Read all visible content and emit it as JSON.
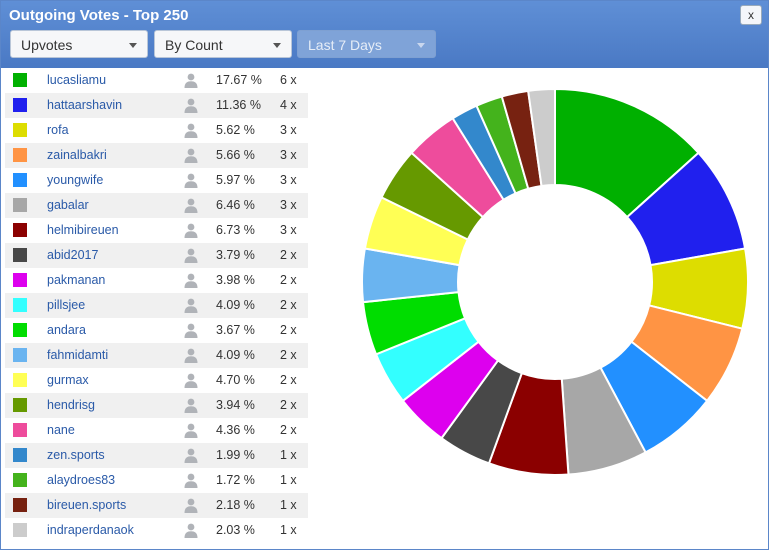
{
  "window": {
    "title": "Outgoing Votes - Top 250",
    "close_label": "x"
  },
  "filters": {
    "vote_type": "Upvotes",
    "sort": "By Count",
    "period": "Last 7 Days"
  },
  "rows": [
    {
      "name": "lucasliamu",
      "percent": "17.67 %",
      "count": "6 x",
      "color": "#00b000",
      "value": 6
    },
    {
      "name": "hattaarshavin",
      "percent": "11.36 %",
      "count": "4 x",
      "color": "#2020ee",
      "value": 4
    },
    {
      "name": "rofa",
      "percent": "5.62 %",
      "count": "3 x",
      "color": "#dddd00",
      "value": 3
    },
    {
      "name": "zainalbakri",
      "percent": "5.66 %",
      "count": "3 x",
      "color": "#ff9444",
      "value": 3
    },
    {
      "name": "youngwife",
      "percent": "5.97 %",
      "count": "3 x",
      "color": "#2290ff",
      "value": 3
    },
    {
      "name": "gabalar",
      "percent": "6.46 %",
      "count": "3 x",
      "color": "#a7a7a7",
      "value": 3
    },
    {
      "name": "helmibireuen",
      "percent": "6.73 %",
      "count": "3 x",
      "color": "#8b0000",
      "value": 3
    },
    {
      "name": "abid2017",
      "percent": "3.79 %",
      "count": "2 x",
      "color": "#484848",
      "value": 2
    },
    {
      "name": "pakmanan",
      "percent": "3.98 %",
      "count": "2 x",
      "color": "#dd00ee",
      "value": 2
    },
    {
      "name": "pillsjee",
      "percent": "4.09 %",
      "count": "2 x",
      "color": "#33ffff",
      "value": 2
    },
    {
      "name": "andara",
      "percent": "3.67 %",
      "count": "2 x",
      "color": "#00dd00",
      "value": 2
    },
    {
      "name": "fahmidamti",
      "percent": "4.09 %",
      "count": "2 x",
      "color": "#6ab4f0",
      "value": 2
    },
    {
      "name": "gurmax",
      "percent": "4.70 %",
      "count": "2 x",
      "color": "#ffff55",
      "value": 2
    },
    {
      "name": "hendrisg",
      "percent": "3.94 %",
      "count": "2 x",
      "color": "#669900",
      "value": 2
    },
    {
      "name": "nane",
      "percent": "4.36 %",
      "count": "2 x",
      "color": "#ee4c9c",
      "value": 2
    },
    {
      "name": "zen.sports",
      "percent": "1.99 %",
      "count": "1 x",
      "color": "#3388cc",
      "value": 1
    },
    {
      "name": "alaydroes83",
      "percent": "1.72 %",
      "count": "1 x",
      "color": "#44b31c",
      "value": 1
    },
    {
      "name": "bireuen.sports",
      "percent": "2.18 %",
      "count": "1 x",
      "color": "#772211",
      "value": 1
    },
    {
      "name": "indraperdanaok",
      "percent": "2.03 %",
      "count": "1 x",
      "color": "#cccccc",
      "value": 1
    }
  ],
  "icons": {
    "user": "user-icon",
    "close": "close-icon",
    "dropdown": "chevron-down-icon"
  },
  "chart_data": {
    "type": "pie",
    "donut": true,
    "categories": [
      "lucasliamu",
      "hattaarshavin",
      "rofa",
      "zainalbakri",
      "youngwife",
      "gabalar",
      "helmibireuen",
      "abid2017",
      "pakmanan",
      "pillsjee",
      "andara",
      "fahmidamti",
      "gurmax",
      "hendrisg",
      "nane",
      "zen.sports",
      "alaydroes83",
      "bireuen.sports",
      "indraperdanaok"
    ],
    "values": [
      6,
      4,
      3,
      3,
      3,
      3,
      3,
      2,
      2,
      2,
      2,
      2,
      2,
      2,
      2,
      1,
      1,
      1,
      1
    ]
  }
}
